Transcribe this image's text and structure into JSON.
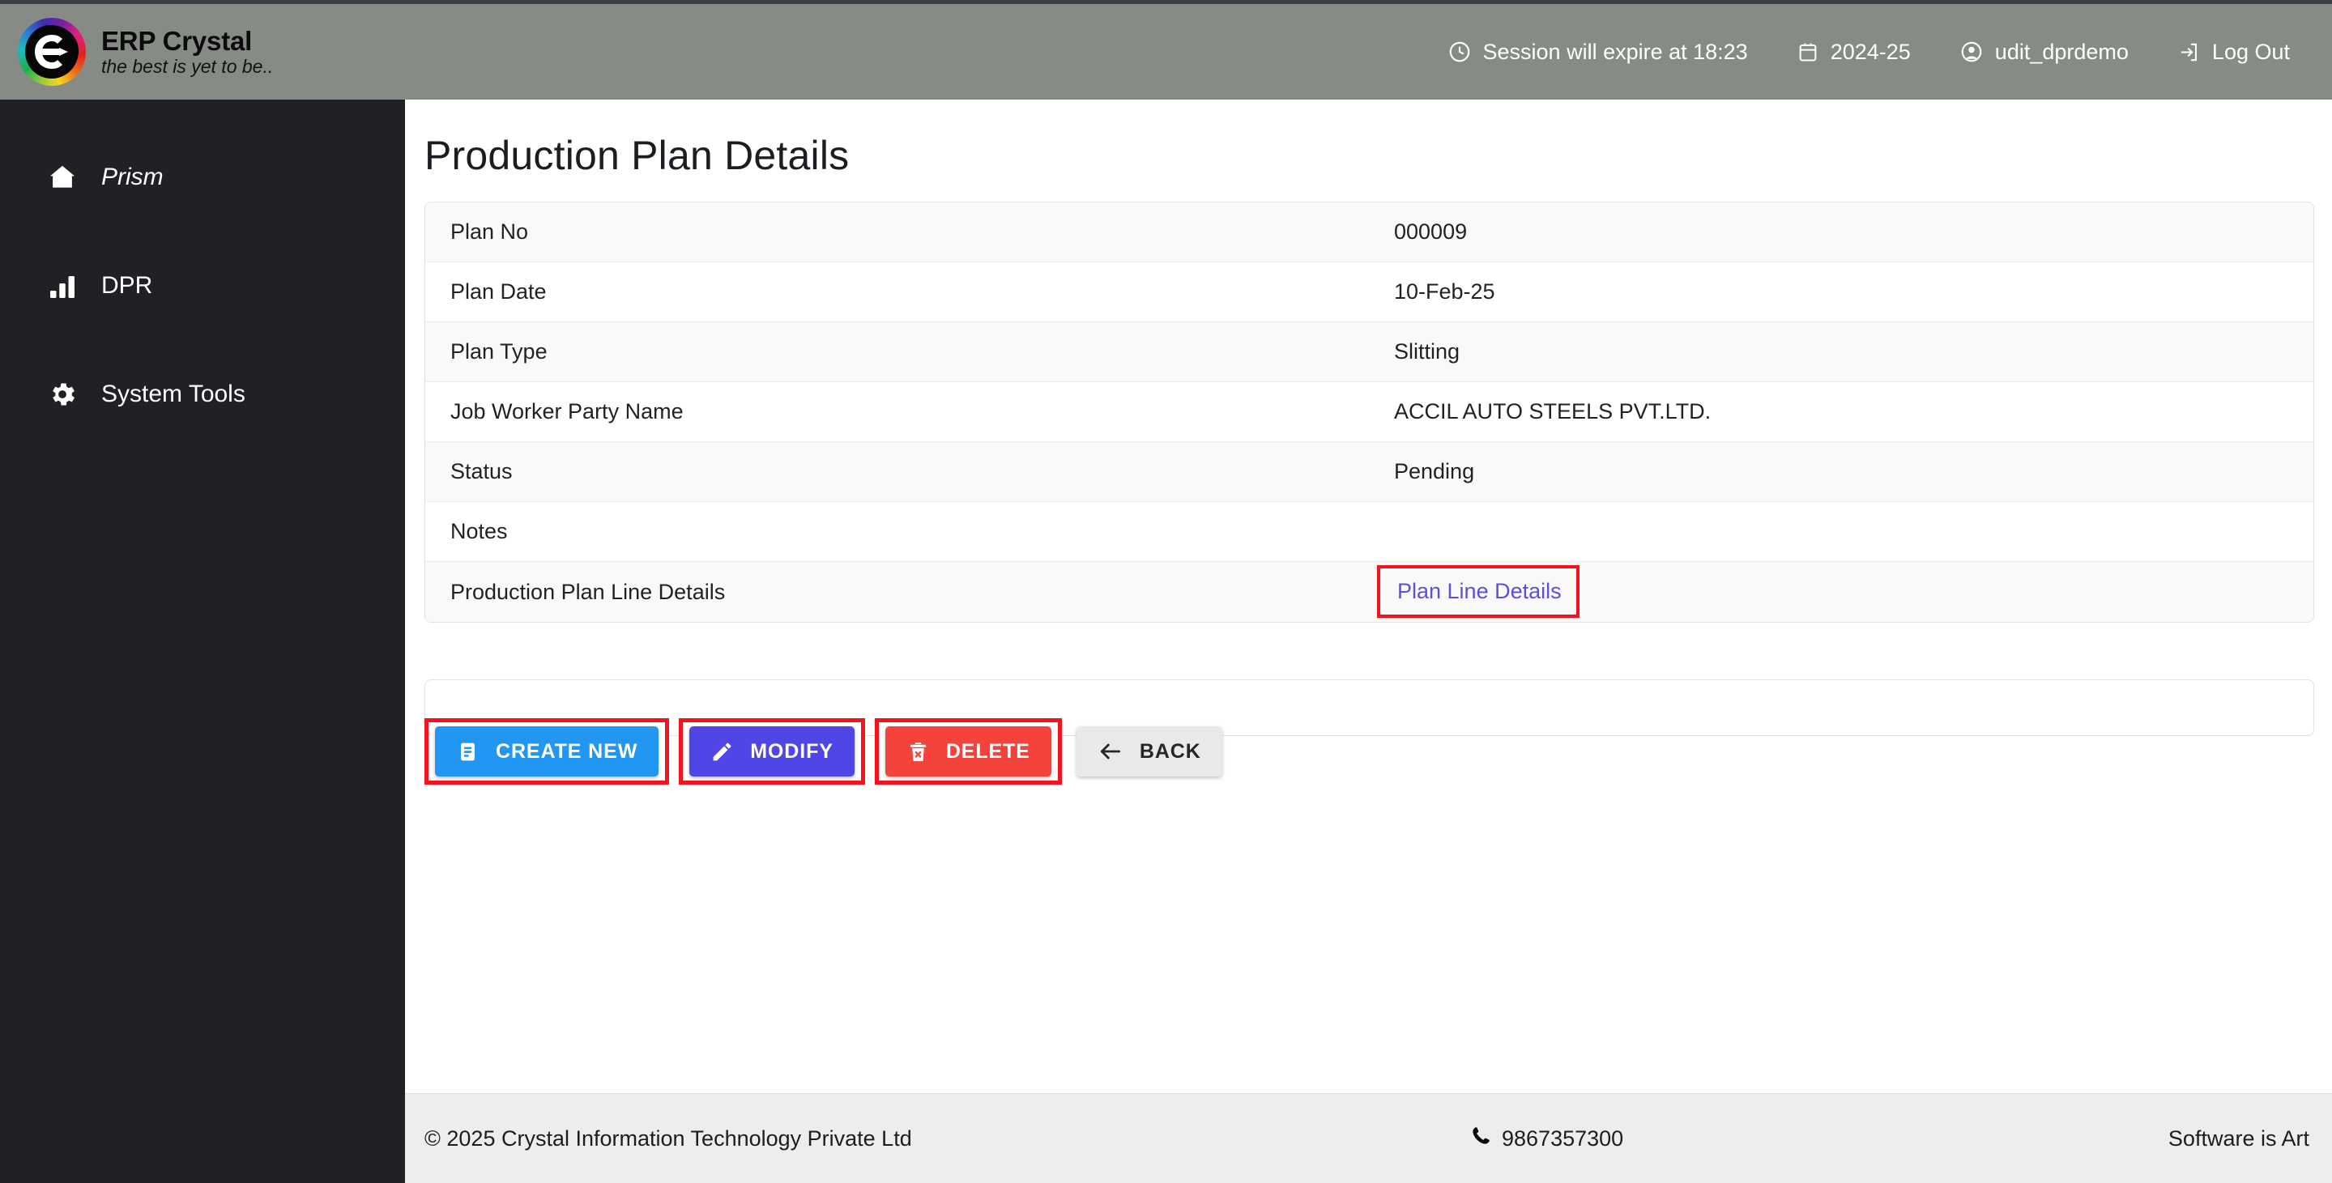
{
  "header": {
    "brand_name": "ERP Crystal",
    "brand_tagline": "the best is yet to be..",
    "logo_icon": "erp-crystal-logo",
    "items": [
      {
        "icon": "clock-icon",
        "label": "Session will expire at 18:23"
      },
      {
        "icon": "calendar-icon",
        "label": "2024-25"
      },
      {
        "icon": "user-icon",
        "label": "udit_dprdemo"
      },
      {
        "icon": "logout-icon",
        "label": "Log Out"
      }
    ]
  },
  "sidebar": {
    "items": [
      {
        "icon": "home-icon",
        "label": "Prism"
      },
      {
        "icon": "bar-chart-icon",
        "label": "DPR"
      },
      {
        "icon": "gear-icon",
        "label": "System Tools"
      }
    ]
  },
  "main": {
    "page_title": "Production Plan Details",
    "details": [
      {
        "label": "Plan No",
        "value": "000009"
      },
      {
        "label": "Plan Date",
        "value": "10-Feb-25"
      },
      {
        "label": "Plan Type",
        "value": "Slitting"
      },
      {
        "label": "Job Worker Party Name",
        "value": "ACCIL AUTO STEELS PVT.LTD."
      },
      {
        "label": "Status",
        "value": "Pending"
      },
      {
        "label": "Notes",
        "value": ""
      },
      {
        "label": "Production Plan Line Details",
        "value": ""
      }
    ],
    "plan_line_link": "Plan Line Details",
    "buttons": [
      {
        "label": "CREATE NEW",
        "icon": "document-icon",
        "color": "#2196f3",
        "annotated": true
      },
      {
        "label": "MODIFY",
        "icon": "pencil-icon",
        "color": "#5046e5",
        "annotated": true
      },
      {
        "label": "DELETE",
        "icon": "trash-delete-icon",
        "color": "#f4433a",
        "annotated": true
      },
      {
        "label": "BACK",
        "icon": "arrow-left-icon",
        "color": "#e9e9e9",
        "annotated": false
      }
    ]
  },
  "footer": {
    "copyright": "© 2025 Crystal Information Technology Private Ltd",
    "phone_icon": "phone-icon",
    "phone": "9867357300",
    "tagline": "Software is Art"
  },
  "colors": {
    "header_bg": "#878b86",
    "sidebar_bg": "#202124",
    "accent_blue": "#2196f3",
    "accent_purple": "#5046e5",
    "accent_red": "#f4433a",
    "annotation_red": "#f5121e",
    "link_purple": "#5a4fe0"
  }
}
